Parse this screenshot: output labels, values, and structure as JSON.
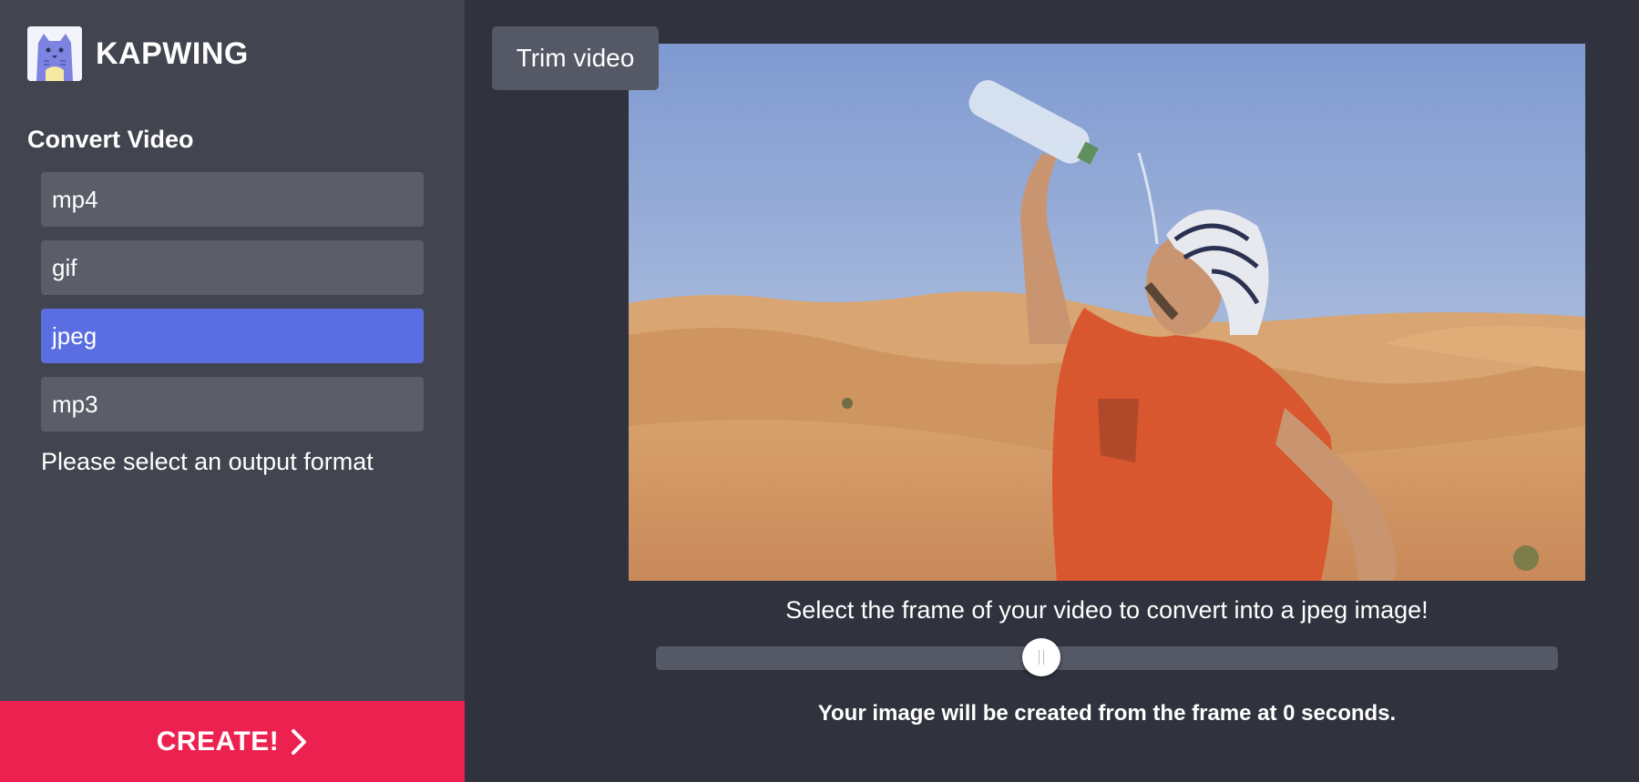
{
  "brand": {
    "name": "KAPWING",
    "logo_icon": "kapwing-cat-logo-icon"
  },
  "sidebar": {
    "section_title": "Convert Video",
    "formats": [
      {
        "label": "mp4",
        "selected": false
      },
      {
        "label": "gif",
        "selected": false
      },
      {
        "label": "jpeg",
        "selected": true
      },
      {
        "label": "mp3",
        "selected": false
      }
    ],
    "hint": "Please select an output format",
    "create_label": "CREATE!",
    "create_icon": "chevron-right-icon"
  },
  "main": {
    "trim_label": "Trim video",
    "caption": "Select the frame of your video to convert into a jpeg image!",
    "slider_position": 0.43,
    "status": "Your image will be created from the frame at 0 seconds."
  },
  "colors": {
    "sidebar_bg": "#42454f",
    "main_bg": "#30333e",
    "button_bg": "#5b5d69",
    "active_accent": "#5b6ee1",
    "create_red": "#ed2150"
  }
}
